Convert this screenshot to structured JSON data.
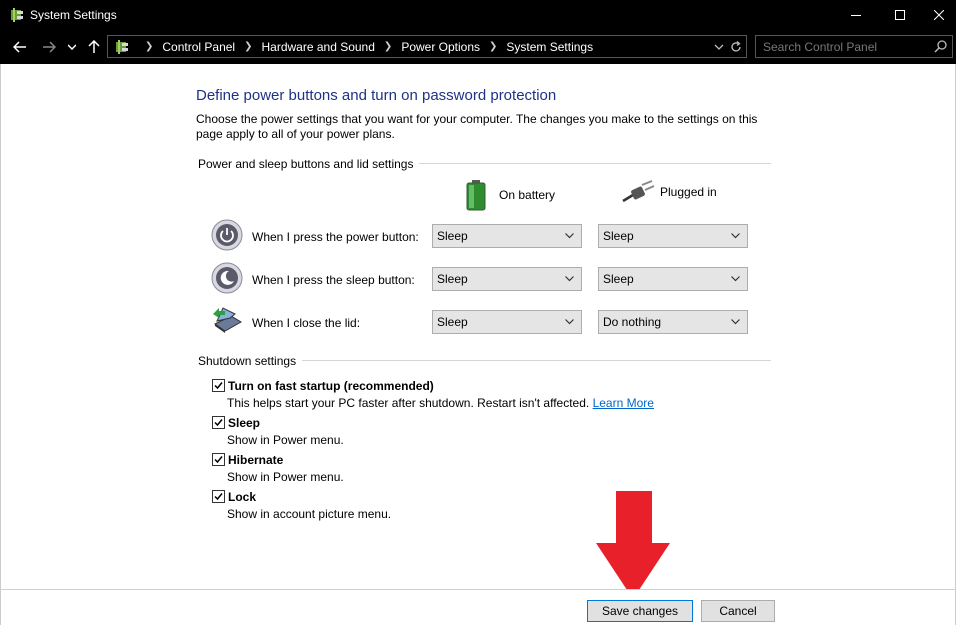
{
  "window": {
    "title": "System Settings"
  },
  "address": {
    "crumbs": [
      "Control Panel",
      "Hardware and Sound",
      "Power Options",
      "System Settings"
    ]
  },
  "search": {
    "placeholder": "Search Control Panel"
  },
  "page": {
    "heading": "Define power buttons and turn on password protection",
    "description": "Choose the power settings that you want for your computer. The changes you make to the settings on this page apply to all of your power plans."
  },
  "power_section": {
    "title": "Power and sleep buttons and lid settings",
    "col_battery": "On battery",
    "col_plugged": "Plugged in",
    "rows": [
      {
        "label": "When I press the power button:",
        "battery": "Sleep",
        "plugged": "Sleep",
        "icon": "power-button-icon"
      },
      {
        "label": "When I press the sleep button:",
        "battery": "Sleep",
        "plugged": "Sleep",
        "icon": "sleep-button-icon"
      },
      {
        "label": "When I close the lid:",
        "battery": "Sleep",
        "plugged": "Do nothing",
        "icon": "laptop-lid-icon"
      }
    ]
  },
  "shutdown_section": {
    "title": "Shutdown settings",
    "items": [
      {
        "label": "Turn on fast startup (recommended)",
        "desc": "This helps start your PC faster after shutdown. Restart isn't affected.",
        "link": "Learn More",
        "checked": true
      },
      {
        "label": "Sleep",
        "desc": "Show in Power menu.",
        "checked": true
      },
      {
        "label": "Hibernate",
        "desc": "Show in Power menu.",
        "checked": true
      },
      {
        "label": "Lock",
        "desc": "Show in account picture menu.",
        "checked": true
      }
    ]
  },
  "footer": {
    "save_label": "Save changes",
    "cancel_label": "Cancel"
  },
  "colors": {
    "heading": "#1e3287",
    "link": "#0066cc",
    "arrow": "#e8202a",
    "titlebar": "#000000"
  }
}
